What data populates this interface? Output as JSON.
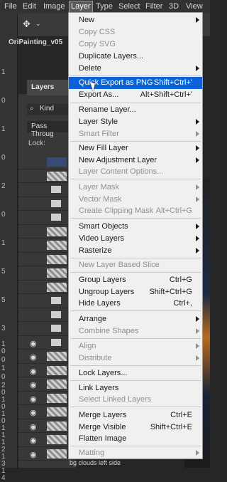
{
  "menubar": {
    "items": [
      "File",
      "Edit",
      "Image",
      "Layer",
      "Type",
      "Select",
      "Filter",
      "3D",
      "View"
    ]
  },
  "document": {
    "tab_title": "OriPainting_v05"
  },
  "layers_panel": {
    "tab": "Layers",
    "filter_label": "Kind",
    "blend_mode": "Pass Throug",
    "lock_label": "Lock:",
    "bottom_layer_name": "bg clouds left side"
  },
  "rulers": [
    "1",
    "0",
    "1",
    "0",
    "2",
    "0",
    "1",
    "5",
    "5",
    "3",
    "1",
    "0",
    "0",
    "1",
    "0",
    "2",
    "0",
    "1",
    "0",
    "1",
    "0",
    "1",
    "1",
    "1",
    "2",
    "1",
    "3",
    "1",
    "4"
  ],
  "layer_menu": {
    "items": [
      {
        "label": "New",
        "arrow": true
      },
      {
        "label": "Copy CSS",
        "disabled": true
      },
      {
        "label": "Copy SVG",
        "disabled": true
      },
      {
        "label": "Duplicate Layers..."
      },
      {
        "label": "Delete",
        "arrow": true
      },
      {
        "label": "Quick Export as PNG",
        "shortcut": "Shift+Ctrl+'",
        "highlight": true
      },
      {
        "label": "Export As...",
        "shortcut": "Alt+Shift+Ctrl+'"
      },
      {
        "label": "Rename Layer..."
      },
      {
        "label": "Layer Style",
        "arrow": true
      },
      {
        "label": "Smart Filter",
        "disabled": true,
        "arrow": true
      },
      {
        "label": "New Fill Layer",
        "arrow": true
      },
      {
        "label": "New Adjustment Layer",
        "arrow": true
      },
      {
        "label": "Layer Content Options...",
        "disabled": true
      },
      {
        "label": "Layer Mask",
        "disabled": true,
        "arrow": true
      },
      {
        "label": "Vector Mask",
        "disabled": true,
        "arrow": true
      },
      {
        "label": "Create Clipping Mask",
        "shortcut": "Alt+Ctrl+G",
        "disabled": true
      },
      {
        "label": "Smart Objects",
        "arrow": true
      },
      {
        "label": "Video Layers",
        "arrow": true
      },
      {
        "label": "Rasterize",
        "arrow": true
      },
      {
        "label": "New Layer Based Slice",
        "disabled": true
      },
      {
        "label": "Group Layers",
        "shortcut": "Ctrl+G"
      },
      {
        "label": "Ungroup Layers",
        "shortcut": "Shift+Ctrl+G"
      },
      {
        "label": "Hide Layers",
        "shortcut": "Ctrl+,"
      },
      {
        "label": "Arrange",
        "arrow": true
      },
      {
        "label": "Combine Shapes",
        "disabled": true,
        "arrow": true
      },
      {
        "label": "Align",
        "disabled": true,
        "arrow": true
      },
      {
        "label": "Distribute",
        "disabled": true,
        "arrow": true
      },
      {
        "label": "Lock Layers..."
      },
      {
        "label": "Link Layers"
      },
      {
        "label": "Select Linked Layers",
        "disabled": true
      },
      {
        "label": "Merge Layers",
        "shortcut": "Ctrl+E"
      },
      {
        "label": "Merge Visible",
        "shortcut": "Shift+Ctrl+E"
      },
      {
        "label": "Flatten Image"
      },
      {
        "label": "Matting",
        "disabled": true,
        "arrow": true
      }
    ]
  },
  "colors": {
    "menu_highlight": "#0a64d6",
    "menu_background": "#f0f0f0",
    "disabled_text": "#8f8f8f",
    "app_background": "#262626"
  }
}
